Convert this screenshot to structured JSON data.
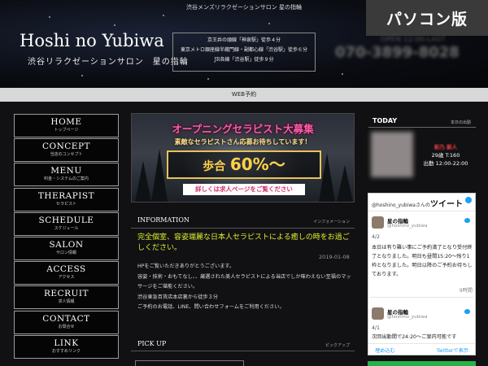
{
  "header": {
    "top_tag": "渋谷メンズリラクゼーションサロン 星の指輪",
    "pc_badge": "パソコン版",
    "logo": "Hoshi no Yubiwa",
    "logo_sub": "渋谷リラクゼーションサロン　星の指輪",
    "access_lines": [
      "京王井の頭線「神泉駅」徒歩４分",
      "東京メトロ銀座線半蔵門線・副都心線「渋谷駅」徒歩６分",
      "JR各線「渋谷駅」徒歩９分"
    ],
    "open_hours": "OPEN 12:00-LAST",
    "tel": "070-3899-8028"
  },
  "web_bar": "WEB予約",
  "nav": [
    {
      "en": "HOME",
      "jp": "トップページ"
    },
    {
      "en": "CONCEPT",
      "jp": "当店のコンセプト"
    },
    {
      "en": "MENU",
      "jp": "料金・システムのご案内"
    },
    {
      "en": "THERAPIST",
      "jp": "セラピスト"
    },
    {
      "en": "SCHEDULE",
      "jp": "スケジュール"
    },
    {
      "en": "SALON",
      "jp": "サロン情報"
    },
    {
      "en": "ACCESS",
      "jp": "アクセス"
    },
    {
      "en": "RECRUIT",
      "jp": "求人情報"
    },
    {
      "en": "CONTACT",
      "jp": "お問合せ"
    },
    {
      "en": "LINK",
      "jp": "おすすめリンク"
    }
  ],
  "banner": {
    "title": "オープニングセラピスト大募集",
    "subtitle": "素敵なセラピストさん応募お待ちしています！",
    "rate_label": "歩合",
    "rate_value": "60%～",
    "detail_button": "詳しくは求人ページをご覧ください"
  },
  "information": {
    "heading": "INFORMATION",
    "heading_sub": "インフォメーション",
    "title": "完全個室、容姿端麗な日本人セラピストによる癒しの時をお過ごしください。",
    "date": "2019-01-08",
    "body": [
      "HPをご覧いただきありがとうございます。",
      "容姿・技術・おもてなし、、厳選された美人セラピストによる当店でしか味わえない至福のマッサージをご堪能ください。",
      "渋谷東急百貨店本店裏から徒歩３分",
      "ご予約のお電話、LINE、問い合わせフォームをご利用ください。"
    ]
  },
  "pickup": {
    "heading": "PICK UP",
    "heading_sub": "ピックアップ"
  },
  "today": {
    "heading": "TODAY",
    "heading_sub": "本日の出勤",
    "therapist_name": "彩乃 新人",
    "therapist_stats": "29歳 T:160",
    "therapist_time": "出勤 12:00-22:00"
  },
  "twitter": {
    "handle_text": "@hoshino_yubiwaさんの",
    "tweets_label": "ツイート",
    "tweets": [
      {
        "name": "星の指輪",
        "handle": "@hoshino_yubiwa",
        "date": "4/2",
        "text": "本日は有り難い事にご予約満了となり受付終了となりました。明日も昼間15:20～残り1枠となりました。明日以降のご予約お待ちしております。",
        "time": "9時間"
      },
      {
        "name": "星の指輪",
        "handle": "@hoshino_yubiwa",
        "date": "4/1",
        "text": "次回出勤間で24:20～ご案内可能です"
      }
    ],
    "embed_label": "埋め込む",
    "view_label": "Twitterで表示"
  }
}
